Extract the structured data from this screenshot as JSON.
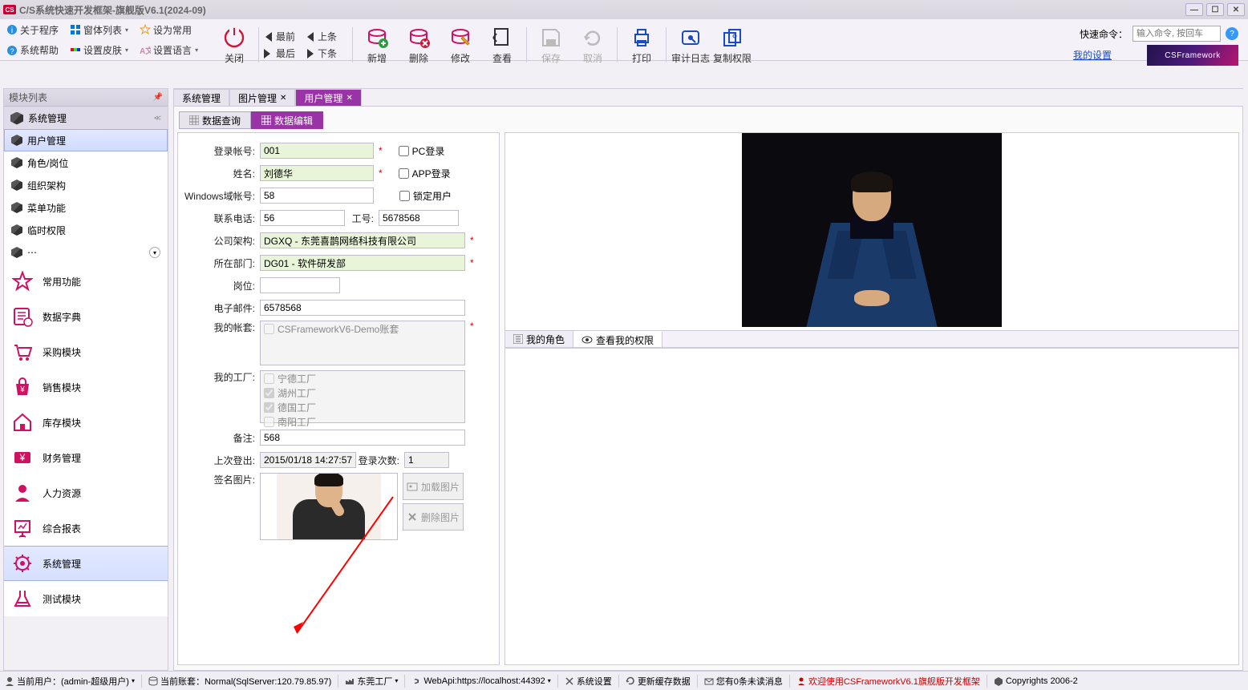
{
  "titlebar": {
    "title": "C/S系统快速开发框架-旗舰版V6.1(2024-09)"
  },
  "menu": {
    "about": "关于程序",
    "windows": "窗体列表",
    "default": "设为常用",
    "help": "系统帮助",
    "skin": "设置皮肤",
    "lang": "设置语言"
  },
  "toolbar": {
    "close": "关闭",
    "first": "最前",
    "last": "最后",
    "prev": "上条",
    "next": "下条",
    "add": "新增",
    "del": "删除",
    "edit": "修改",
    "view": "查看",
    "save": "保存",
    "cancel": "取消",
    "print": "打印",
    "audit": "审计日志",
    "perm": "复制权限",
    "quick": "快速命令：",
    "quick_ph": "输入命令, 按回车",
    "mysettings": "我的设置",
    "logo": "CSFramework"
  },
  "left": {
    "title": "模块列表",
    "sec0": "系统管理",
    "items": [
      "用户管理",
      "角色/岗位",
      "组织架构",
      "菜单功能",
      "临时权限"
    ],
    "big": [
      "常用功能",
      "数据字典",
      "采购模块",
      "销售模块",
      "库存模块",
      "财务管理",
      "人力资源",
      "综合报表",
      "系统管理",
      "测试模块"
    ]
  },
  "doctabs": [
    "系统管理",
    "图片管理",
    "用户管理"
  ],
  "innertabs": [
    "数据查询",
    "数据编辑"
  ],
  "form": {
    "l_account": "登录帐号:",
    "v_account": "001",
    "l_name": "姓名:",
    "v_name": "刘德华",
    "l_winacc": "Windows域帐号:",
    "v_winacc": "58",
    "l_phone": "联系电话:",
    "v_phone": "56",
    "l_workno": "工号:",
    "v_workno": "5678568",
    "l_company": "公司架构:",
    "v_company": "DGXQ - 东莞喜鹊网络科技有限公司",
    "l_dept": "所在部门:",
    "v_dept": "DG01 - 软件研发部",
    "l_post": "岗位:",
    "l_email": "电子邮件:",
    "v_email": "6578568",
    "l_myacc": "我的帐套:",
    "v_myacc": "CSFrameworkV6-Demo账套",
    "l_myfact": "我的工厂:",
    "facts": [
      "宁德工厂",
      "湖州工厂",
      "德国工厂",
      "南阳工厂"
    ],
    "l_remark": "备注:",
    "v_remark": "568",
    "l_last": "上次登出:",
    "v_last": "2015/01/18 14:27:57",
    "l_count": "登录次数:",
    "v_count": "1",
    "l_sign": "签名图片:",
    "b_load": "加载图片",
    "b_del": "删除图片",
    "chk_pc": "PC登录",
    "chk_app": "APP登录",
    "chk_lock": "锁定用户"
  },
  "rtabs": {
    "role": "我的角色",
    "perm": "查看我的权限"
  },
  "status": {
    "user": "当前用户：(admin-超级用户)",
    "dataset": "当前账套：Normal(SqlServer:120.79.85.97)",
    "factory": "东莞工厂",
    "webapi": "WebApi:https://localhost:44392",
    "syscfg": "系统设置",
    "refresh": "更新缓存数据",
    "msg": "您有0条未读消息",
    "welcome": "欢迎使用CSFrameworkV6.1旗舰版开发框架",
    "copy": "Copyrights 2006-2"
  }
}
